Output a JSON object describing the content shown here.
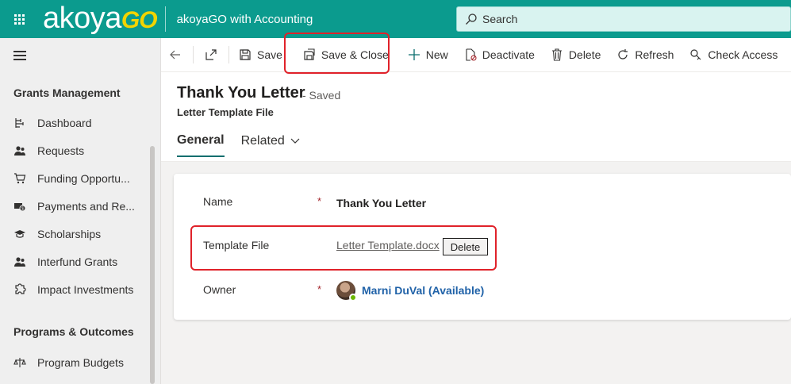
{
  "topbar": {
    "logo_text": "akoya",
    "logo_go": "GO",
    "app_title": "akoyaGO with Accounting",
    "search_placeholder": "Search"
  },
  "nav": {
    "group1": "Grants Management",
    "items1": [
      {
        "label": "Dashboard",
        "icon": "dashboard-icon"
      },
      {
        "label": "Requests",
        "icon": "people-icon"
      },
      {
        "label": "Funding Opportu...",
        "icon": "cart-icon"
      },
      {
        "label": "Payments and Re...",
        "icon": "payments-icon"
      },
      {
        "label": "Scholarships",
        "icon": "graduation-cap-icon"
      },
      {
        "label": "Interfund Grants",
        "icon": "people-icon"
      },
      {
        "label": "Impact Investments",
        "icon": "puzzle-icon"
      }
    ],
    "group2": "Programs & Outcomes",
    "items2": [
      {
        "label": "Program Budgets",
        "icon": "budget-icon"
      }
    ]
  },
  "commands": {
    "save": "Save",
    "save_close": "Save & Close",
    "new": "New",
    "deactivate": "Deactivate",
    "delete": "Delete",
    "refresh": "Refresh",
    "check_access": "Check Access"
  },
  "record": {
    "title": "Thank You Letter",
    "status": "- Saved",
    "entity": "Letter Template File"
  },
  "tabs": {
    "general": "General",
    "related": "Related"
  },
  "form": {
    "name_label": "Name",
    "name_required": "*",
    "name_value": "Thank You Letter",
    "file_label": "Template File",
    "file_value": "Letter Template.docx",
    "file_delete": "Delete",
    "owner_label": "Owner",
    "owner_required": "*",
    "owner_value": "Marni DuVal (Available)"
  },
  "colors": {
    "brand_teal": "#0b9b8e",
    "logo_go": "#f2d400",
    "highlight_red": "#e0222a",
    "link_blue": "#2062a8"
  }
}
